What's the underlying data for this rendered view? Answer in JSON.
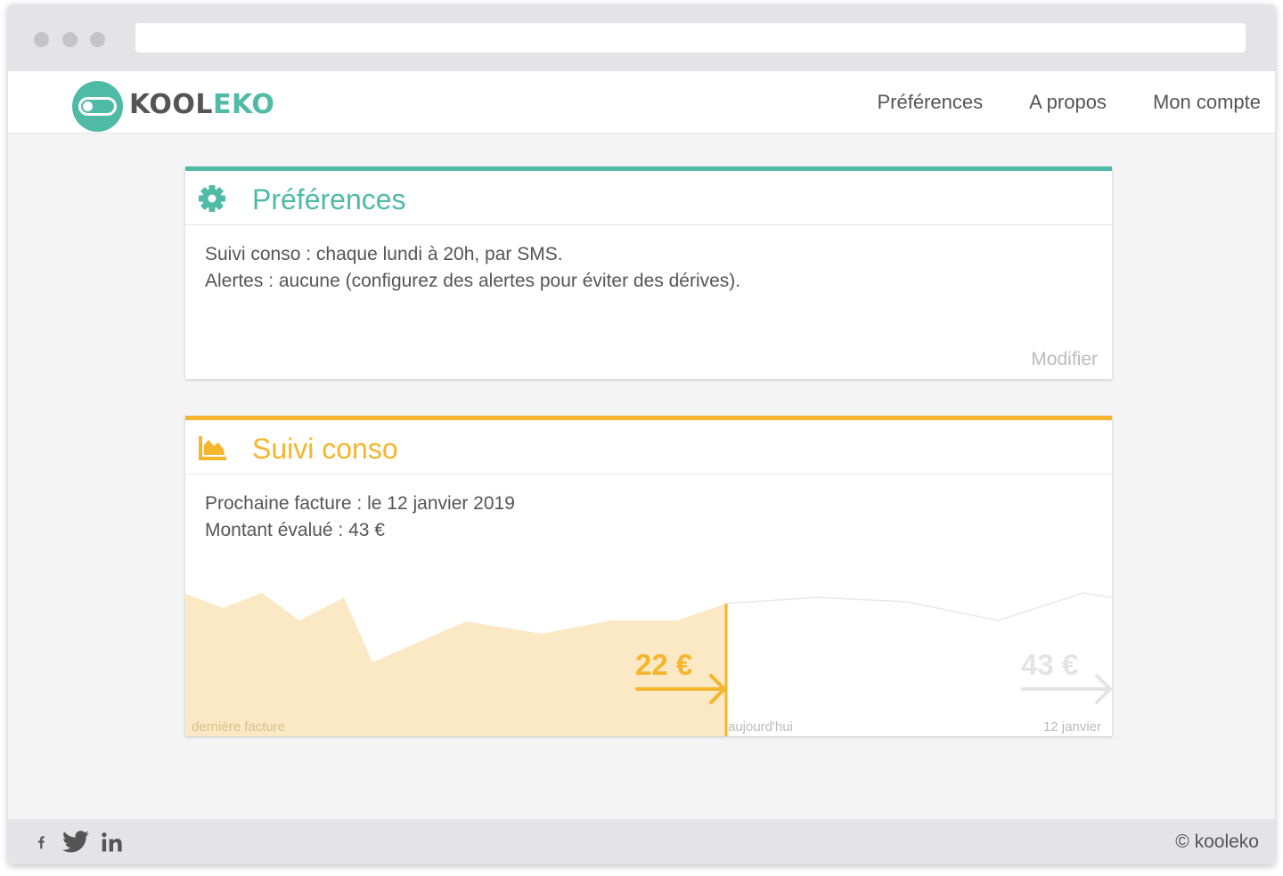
{
  "brand": {
    "name_part1": "KOOL",
    "name_part2": "EKO",
    "accent_color": "#4fbaa5",
    "secondary_color": "#f5b52d"
  },
  "nav": {
    "items": [
      {
        "label": "Préférences"
      },
      {
        "label": "A propos"
      },
      {
        "label": "Mon compte"
      }
    ]
  },
  "preferences_card": {
    "icon": "gear-icon",
    "title": "Préférences",
    "lines": [
      "Suivi conso : chaque lundi à 20h, par SMS.",
      "Alertes : aucune (configurez des alertes pour éviter des dérives)."
    ],
    "edit_label": "Modifier"
  },
  "conso_card": {
    "icon": "area-chart-icon",
    "title": "Suivi conso",
    "lines": [
      "Prochaine facture : le 12 janvier 2019",
      "Montant évalué : 43 €"
    ],
    "current_amount": "22 €",
    "forecast_amount": "43 €",
    "timeline_labels": {
      "start": "dernière facture",
      "today": "aujourd'hui",
      "end": "12 janvier"
    },
    "today_fraction": 0.585
  },
  "footer": {
    "social": [
      "facebook-icon",
      "twitter-icon",
      "linkedin-icon"
    ],
    "copyright": "© kooleko"
  }
}
